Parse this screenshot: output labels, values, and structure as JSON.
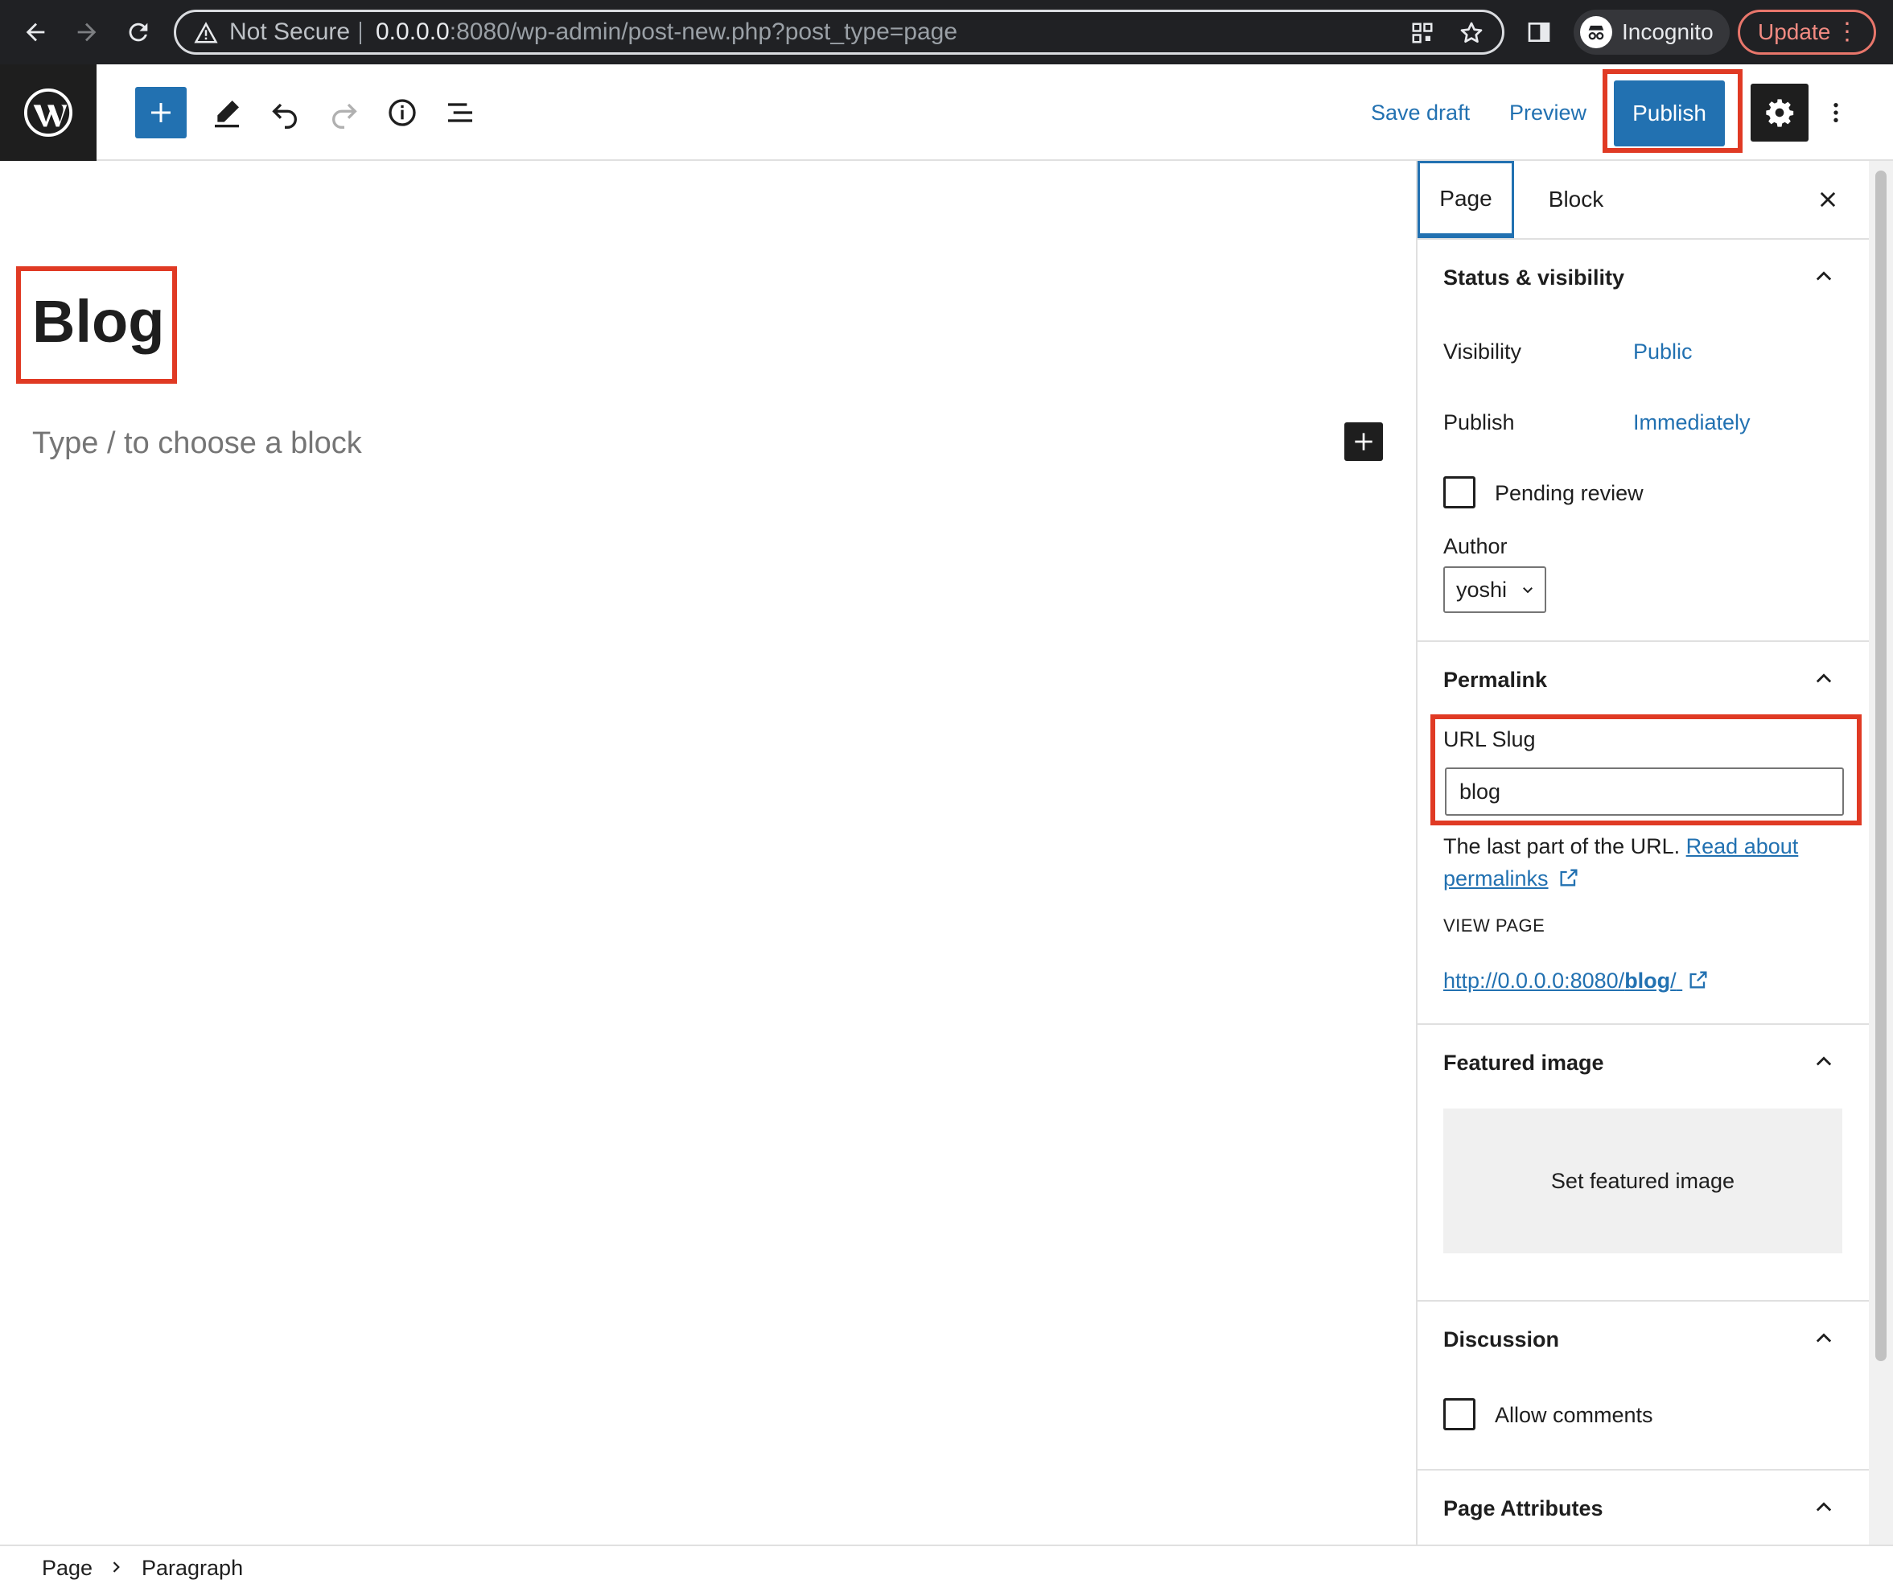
{
  "browser": {
    "security_label": "Not Secure",
    "url_host": "0.0.0.0",
    "url_rest": ":8080/wp-admin/post-new.php?post_type=page",
    "incognito_label": "Incognito",
    "update_label": "Update"
  },
  "toolbar": {
    "save_draft": "Save draft",
    "preview": "Preview",
    "publish": "Publish"
  },
  "editor": {
    "title": "Blog",
    "placeholder": "Type / to choose a block"
  },
  "sidebar": {
    "tabs": [
      "Page",
      "Block"
    ],
    "status": {
      "title": "Status & visibility",
      "visibility_label": "Visibility",
      "visibility_value": "Public",
      "publish_label": "Publish",
      "publish_value": "Immediately",
      "pending_label": "Pending review",
      "author_label": "Author",
      "author_value": "yoshi"
    },
    "permalink": {
      "title": "Permalink",
      "slug_label": "URL Slug",
      "slug_value": "blog",
      "help_text": "The last part of the URL.",
      "help_link_1": "Read about",
      "help_link_2": "permalinks",
      "view_page_label": "VIEW PAGE",
      "view_url_base": "http://0.0.0.0:8080/",
      "view_url_slug": "blog",
      "view_url_end": "/"
    },
    "featured": {
      "title": "Featured image",
      "button": "Set featured image"
    },
    "discussion": {
      "title": "Discussion",
      "allow_comments": "Allow comments"
    },
    "attributes": {
      "title": "Page Attributes"
    }
  },
  "breadcrumb": [
    "Page",
    "Paragraph"
  ],
  "colors": {
    "accent": "#2271b1",
    "highlight": "#e03a24",
    "dark": "#1e1e1e"
  }
}
